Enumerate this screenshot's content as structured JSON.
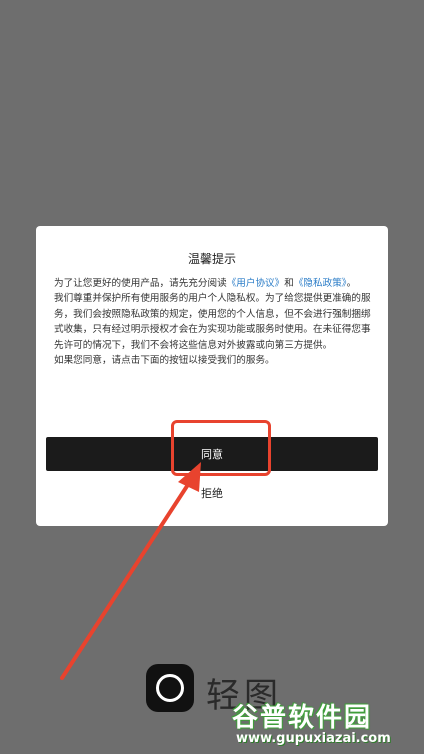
{
  "dialog": {
    "title": "温馨提示",
    "para1_pre": "为了让您更好的使用产品，请先充分阅读",
    "user_agreement_link": "《用户协议》",
    "para1_mid": "和",
    "privacy_policy_link": "《隐私政策》",
    "para1_post": "。",
    "para2": "我们尊重并保护所有使用服务的用户个人隐私权。为了给您提供更准确的服务，我们会按照隐私政策的规定，使用您的个人信息，但不会进行强制捆绑式收集，只有经过明示授权才会在为实现功能或服务时使用。在未征得您事先许可的情况下，我们不会将这些信息对外披露或向第三方提供。",
    "para3": "如果您同意，请点击下面的按钮以接受我们的服务。",
    "agree_label": "同意",
    "reject_label": "拒绝"
  },
  "app": {
    "name": "轻图"
  },
  "watermark": {
    "main": "谷普软件园",
    "url": "www.gupuxiazai.com"
  },
  "colors": {
    "overlay": "#6e6e6e",
    "link": "#2a7cc7",
    "button": "#1b1b1b",
    "highlight": "#e8432e"
  }
}
